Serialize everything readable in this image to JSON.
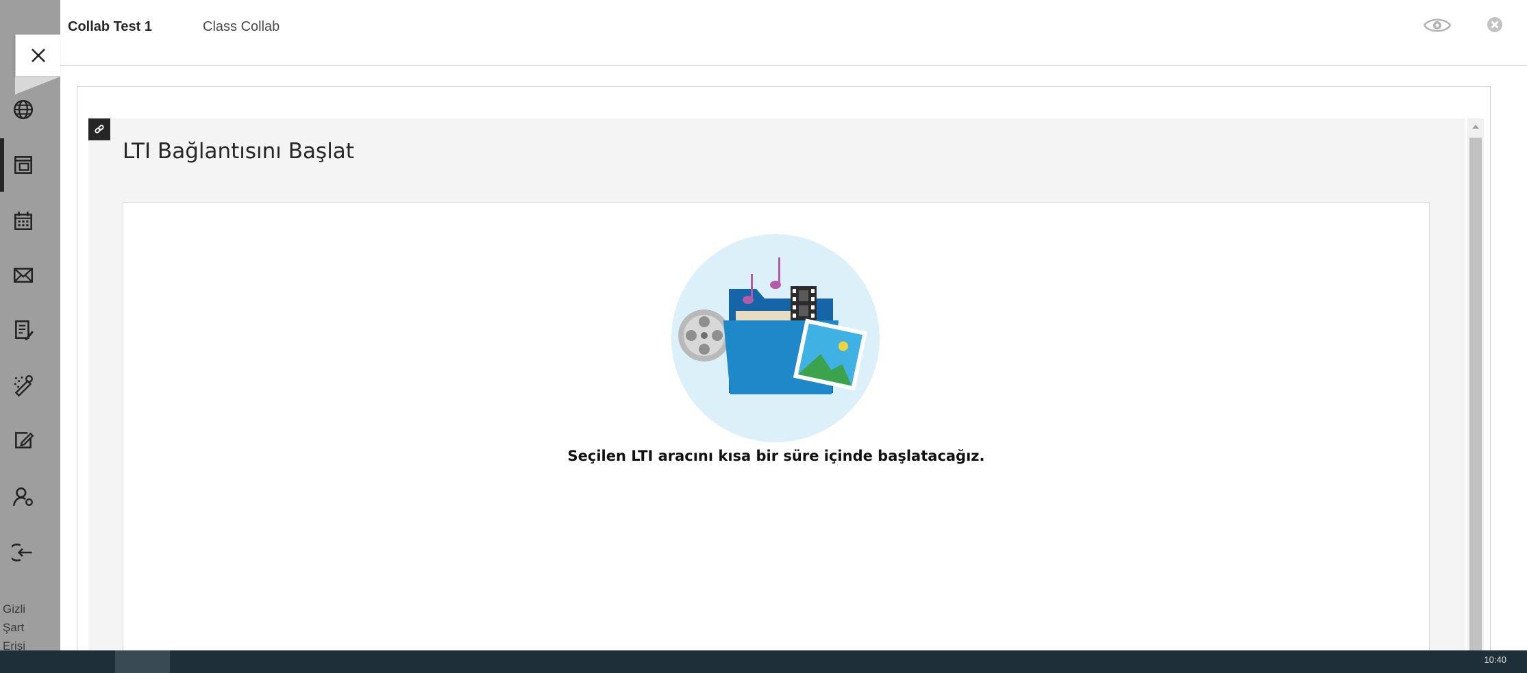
{
  "header": {
    "title": "Collab Test 1",
    "subtitle": "Class Collab"
  },
  "rail": {
    "icons": [
      "globe-icon",
      "course-icon",
      "calendar-icon",
      "mail-icon",
      "grades-icon",
      "tools-icon",
      "edit-icon",
      "profile-icon",
      "logout-icon"
    ],
    "links": [
      "Gizli",
      "Şart",
      "Erişi"
    ]
  },
  "frame": {
    "badge_icon": "link-icon",
    "title": "LTI Bağlantısını Başlat",
    "message": "Seçilen LTI aracını kısa bir süre içinde başlatacağız."
  },
  "taskbar": {
    "clock": "10:40"
  },
  "colors": {
    "rail_bg": "#9e9e9e",
    "frame_bg": "#f4f4f4",
    "illustration_circle": "#dbf0f8",
    "folder_blue": "#1e88c8",
    "note_purple": "#b25ca8",
    "taskbar_bg": "#1f2f3a"
  }
}
